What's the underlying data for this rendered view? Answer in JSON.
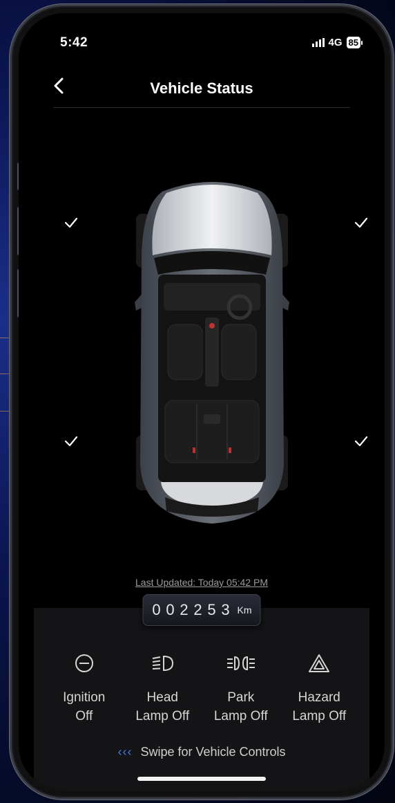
{
  "status_bar": {
    "time": "5:42",
    "network": "4G",
    "battery": "85"
  },
  "nav": {
    "title": "Vehicle Status"
  },
  "doors": [
    {
      "id": "front-left",
      "status": "closed",
      "icon": "check-icon"
    },
    {
      "id": "front-right",
      "status": "closed",
      "icon": "check-icon"
    },
    {
      "id": "rear-left",
      "status": "closed",
      "icon": "check-icon"
    },
    {
      "id": "rear-right",
      "status": "closed",
      "icon": "check-icon"
    }
  ],
  "last_updated": "Last Updated: Today 05:42 PM",
  "odometer": {
    "digits": [
      "0",
      "0",
      "2",
      "2",
      "5",
      "3"
    ],
    "unit": "Km"
  },
  "controls": [
    {
      "line1": "Ignition",
      "line2": "Off",
      "icon": "ignition-icon"
    },
    {
      "line1": "Head",
      "line2": "Lamp Off",
      "icon": "headlamp-icon"
    },
    {
      "line1": "Park",
      "line2": "Lamp Off",
      "icon": "park-lamp-icon"
    },
    {
      "line1": "Hazard",
      "line2": "Lamp Off",
      "icon": "hazard-icon"
    }
  ],
  "swipe": {
    "chevrons": "‹‹‹",
    "label": "Swipe for Vehicle Controls"
  },
  "colors": {
    "accent": "#3d7de0",
    "background": "#000000",
    "text": "#ffffff"
  }
}
